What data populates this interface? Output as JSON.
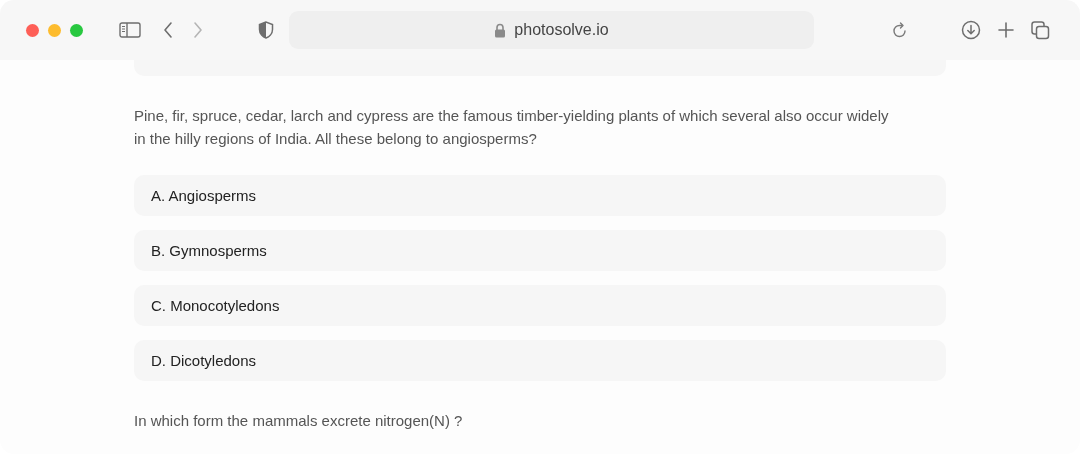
{
  "browser": {
    "url": "photosolve.io"
  },
  "questions": [
    {
      "text": "Pine, fir, spruce, cedar, larch and cypress are the famous timber-yielding plants of which several also occur widely in the hilly regions of India. All these belong to angiosperms?",
      "options": [
        "A. Angiosperms",
        "B. Gymnosperms",
        "C. Monocotyledons",
        "D. Dicotyledons"
      ]
    },
    {
      "text": "In which form the mammals excrete nitrogen(N) ?"
    }
  ]
}
